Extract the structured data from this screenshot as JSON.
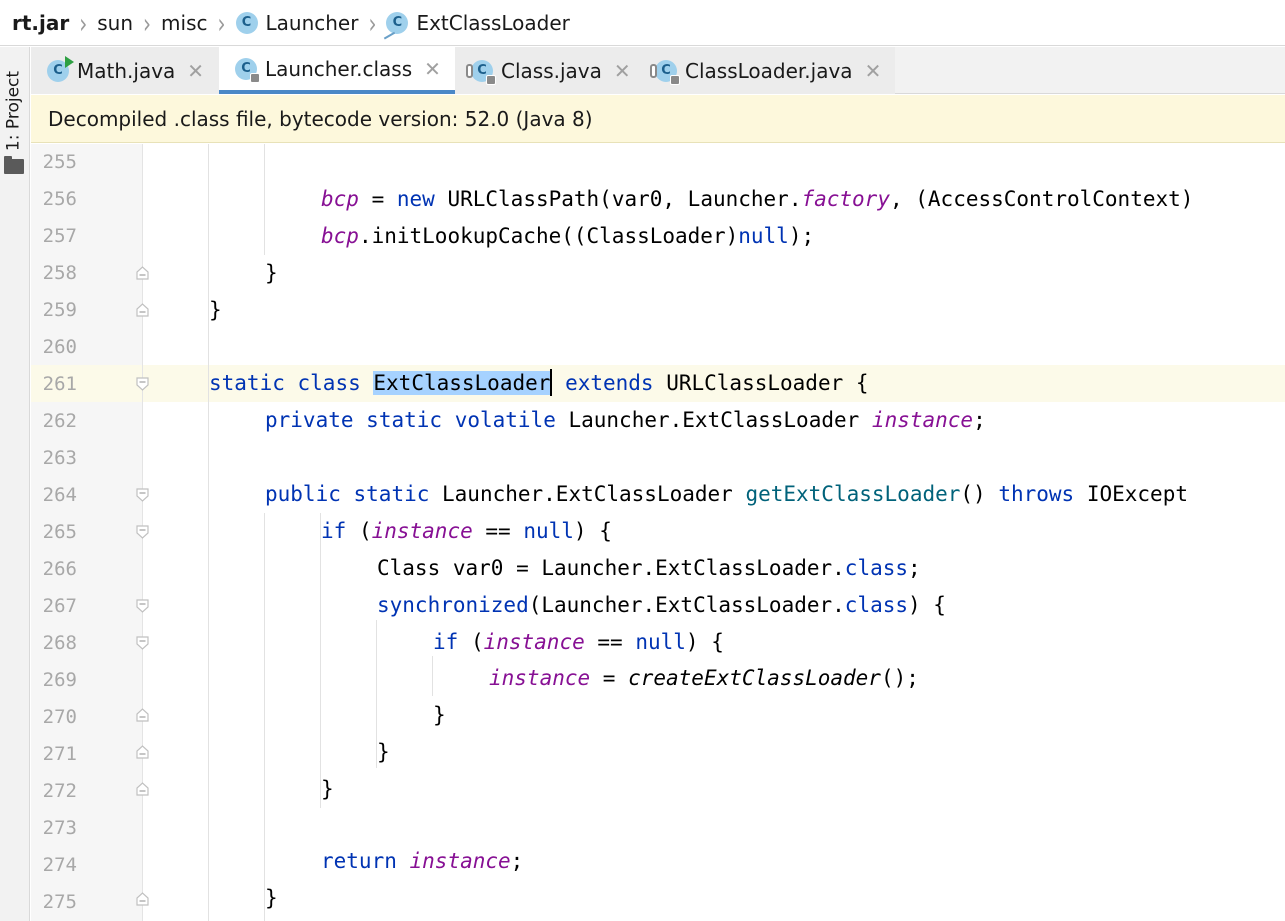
{
  "breadcrumb": {
    "items": [
      {
        "label": "rt.jar",
        "icon": null
      },
      {
        "label": "sun",
        "icon": null
      },
      {
        "label": "misc",
        "icon": null
      },
      {
        "label": "Launcher",
        "icon": "class-icon"
      },
      {
        "label": "ExtClassLoader",
        "icon": "class-icon"
      }
    ]
  },
  "tool_strip": {
    "project_label": "1: Project"
  },
  "tabs": [
    {
      "label": "Math.java",
      "icon": "runnable-class-icon",
      "active": false
    },
    {
      "label": "Launcher.class",
      "icon": "compiled-class-icon",
      "active": true
    },
    {
      "label": "Class.java",
      "icon": "class-icon",
      "active": false
    },
    {
      "label": "ClassLoader.java",
      "icon": "abstract-class-icon",
      "active": false
    }
  ],
  "notice": {
    "text": "Decompiled .class file, bytecode version: 52.0 (Java 8)"
  },
  "editor": {
    "current_line": 261,
    "lines": [
      {
        "num": "255"
      },
      {
        "num": "256"
      },
      {
        "num": "257"
      },
      {
        "num": "258"
      },
      {
        "num": "259"
      },
      {
        "num": "260"
      },
      {
        "num": "261"
      },
      {
        "num": "262"
      },
      {
        "num": "263"
      },
      {
        "num": "264"
      },
      {
        "num": "265"
      },
      {
        "num": "266"
      },
      {
        "num": "267"
      },
      {
        "num": "268"
      },
      {
        "num": "269"
      },
      {
        "num": "270"
      },
      {
        "num": "271"
      },
      {
        "num": "272"
      },
      {
        "num": "273"
      },
      {
        "num": "274"
      },
      {
        "num": "275"
      }
    ],
    "code": {
      "l256": {
        "bcp": "bcp",
        "eq": " = ",
        "new": "new",
        "rest": " URLClassPath(var0, Launcher.",
        "factory": "factory",
        "tail": ", (AccessControlContext)"
      },
      "l257": {
        "bcp": "bcp",
        "call": ".initLookupCache((ClassLoader)",
        "null": "null",
        "end": ");"
      },
      "l258": {
        "text": "}"
      },
      "l259": {
        "text": "}"
      },
      "l261": {
        "static": "static",
        "class": "class",
        "name": "ExtClassLoader",
        "extends": "extends",
        "super": " URLClassLoader {"
      },
      "l262": {
        "private": "private",
        "static": "static",
        "volatile": "volatile",
        "type": " Launcher.ExtClassLoader ",
        "field": "instance",
        "end": ";"
      },
      "l264": {
        "public": "public",
        "static": "static",
        "type": " Launcher.ExtClassLoader ",
        "method": "getExtClassLoader",
        "parens": "() ",
        "throws": "throws",
        "exc": " IOExcept"
      },
      "l265": {
        "if": "if",
        "open": " (",
        "field": "instance",
        "eq": " == ",
        "null": "null",
        "end": ") {"
      },
      "l266": {
        "text1": "Class var0 = Launcher.ExtClassLoader.",
        "class": "class",
        "end": ";"
      },
      "l267": {
        "sync": "synchronized",
        "mid": "(Launcher.ExtClassLoader.",
        "class": "class",
        "end": ") {"
      },
      "l268": {
        "if": "if",
        "open": " (",
        "field": "instance",
        "eq": " == ",
        "null": "null",
        "end": ") {"
      },
      "l269": {
        "field": "instance",
        "eq": " = ",
        "call": "createExtClassLoader",
        "end": "();"
      },
      "l270": {
        "text": "}"
      },
      "l271": {
        "text": "}"
      },
      "l272": {
        "text": "}"
      },
      "l274": {
        "return": "return",
        "field": "instance",
        "end": ";"
      },
      "l275": {
        "text": "}"
      }
    }
  },
  "colors": {
    "keyword": "#0033b3",
    "field": "#871094",
    "method": "#00627a",
    "selection": "#a6d2ff",
    "current_line": "#fcfae9",
    "notice_bg": "#fdf8dc",
    "active_tab_underline": "#4a88c7"
  }
}
